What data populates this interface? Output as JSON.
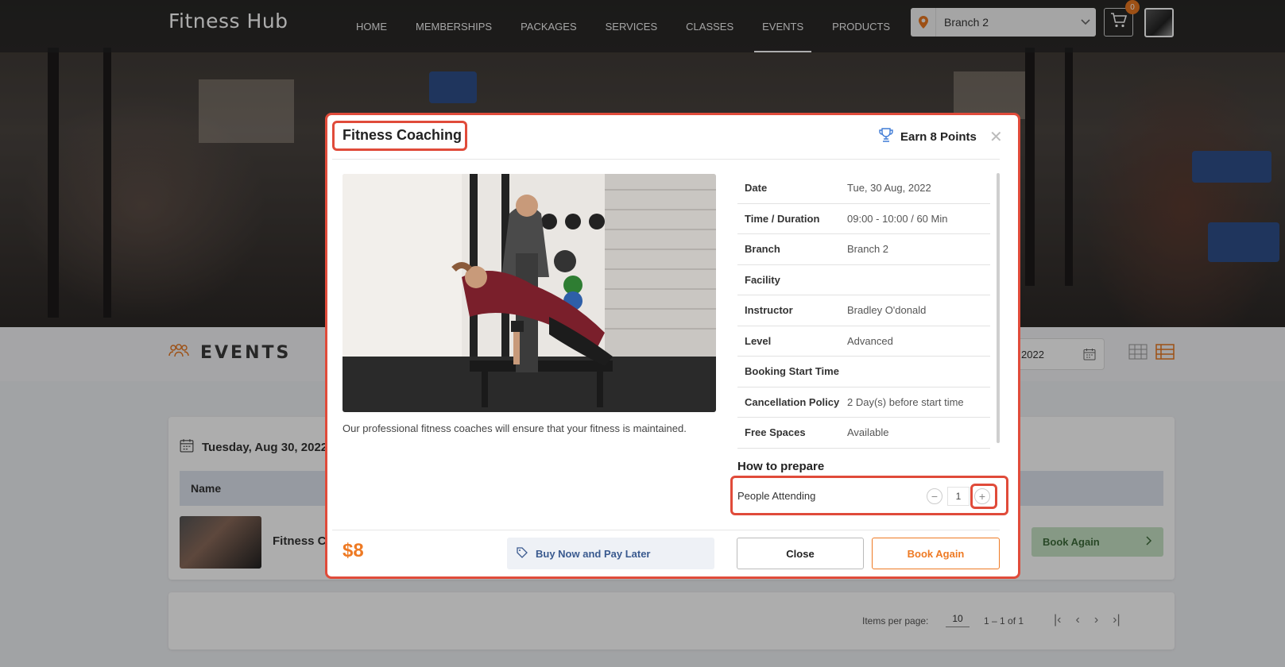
{
  "app": {
    "brand": "Fitness Hub"
  },
  "nav": {
    "items": [
      {
        "label": "HOME"
      },
      {
        "label": "MEMBERSHIPS"
      },
      {
        "label": "PACKAGES"
      },
      {
        "label": "SERVICES"
      },
      {
        "label": "CLASSES"
      },
      {
        "label": "EVENTS",
        "active": true
      },
      {
        "label": "PRODUCTS"
      }
    ],
    "branch": "Branch 2",
    "cart_count": "0"
  },
  "events_page": {
    "title": "EVENTS",
    "date_value": "2022",
    "list_date": "Tuesday, Aug 30, 2022",
    "column_name": "Name",
    "row_name": "Fitness C",
    "row_action": "Book Again",
    "pager": {
      "items_per_page_label": "Items per page:",
      "items_per_page": "10",
      "range": "1 – 1 of 1"
    }
  },
  "modal": {
    "title": "Fitness Coaching",
    "points": "Earn 8 Points",
    "description": "Our professional fitness coaches will ensure that your fitness is maintained.",
    "details": [
      {
        "key": "Date",
        "value": "Tue, 30 Aug, 2022"
      },
      {
        "key": "Time / Duration",
        "value": "09:00 - 10:00 / 60 Min"
      },
      {
        "key": "Branch",
        "value": "Branch 2"
      },
      {
        "key": "Facility",
        "value": ""
      },
      {
        "key": "Instructor",
        "value": "Bradley O'donald"
      },
      {
        "key": "Level",
        "value": "Advanced"
      },
      {
        "key": "Booking Start Time",
        "value": ""
      },
      {
        "key": "Cancellation Policy",
        "value": "2 Day(s) before start time"
      },
      {
        "key": "Free Spaces",
        "value": "Available"
      }
    ],
    "prepare_heading": "How to prepare",
    "people_label": "People Attending",
    "people_count": "1",
    "price": "$8",
    "bnpl_label": "Buy Now and Pay Later",
    "close_label": "Close",
    "book_label": "Book Again"
  },
  "colors": {
    "accent_orange": "#ee7a24",
    "highlight_red": "#e04b3a",
    "book_green_bg": "#c6e2c4"
  },
  "icons": [
    "location-pin-icon",
    "chevron-down-icon",
    "cart-icon",
    "events-group-icon",
    "calendar-icon",
    "grid-view-icon",
    "list-view-icon",
    "trophy-icon",
    "close-icon",
    "tag-icon",
    "minus-icon",
    "plus-icon",
    "chevron-right-icon"
  ]
}
